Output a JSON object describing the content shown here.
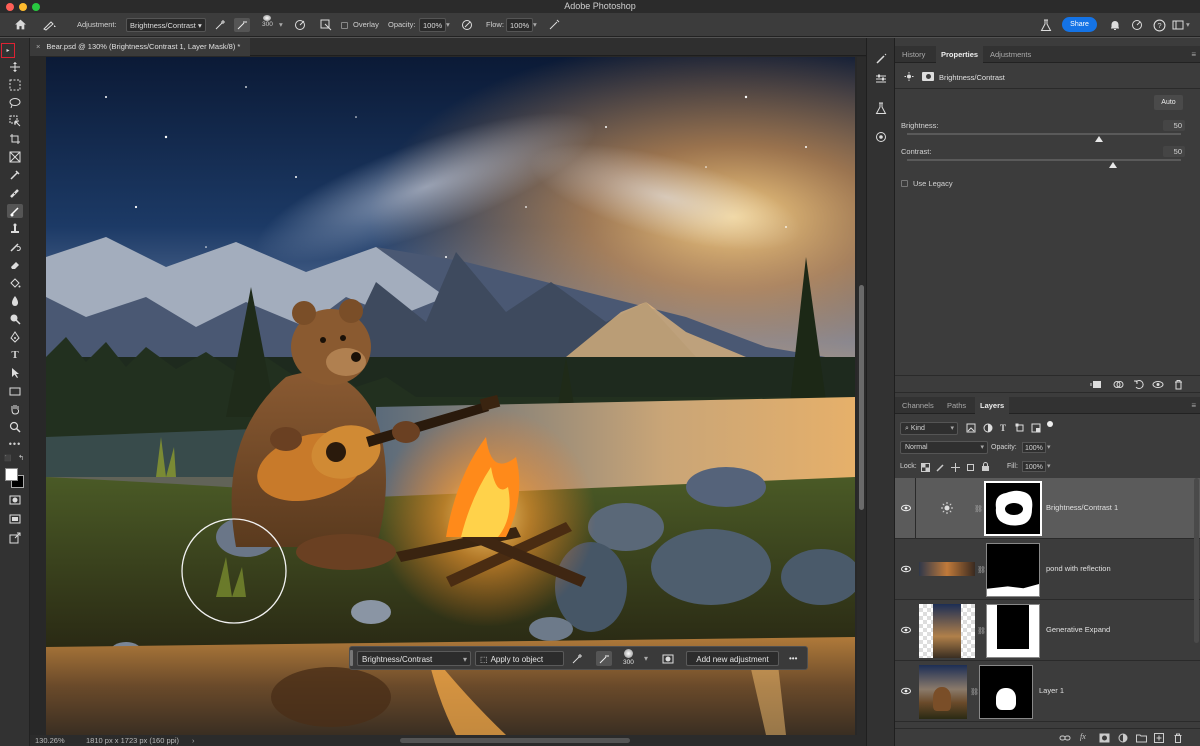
{
  "app": {
    "title": "Adobe Photoshop",
    "share_label": "Share"
  },
  "colors": {
    "accent": "#1473e6",
    "panel_bg": "#3c3c3c",
    "toolbar_bg": "#323232"
  },
  "options_bar": {
    "adjustment_label": "Adjustment:",
    "adjustment_value": "Brightness/Contrast",
    "brush_size": "300",
    "overlay_label": "Overlay",
    "opacity_label": "Opacity:",
    "opacity_value": "100%",
    "flow_label": "Flow:",
    "flow_value": "100%"
  },
  "document": {
    "tab_label": "Bear.psd @ 130% (Brightness/Contrast 1, Layer Mask/8) *",
    "zoom": "130.26%",
    "dimensions": "1810 px x 1723 px (160 ppi)"
  },
  "taskbar": {
    "adjustment": "Brightness/Contrast",
    "apply_label": "Apply to object",
    "brush_size": "300",
    "add_label": "Add new adjustment",
    "more": "•••"
  },
  "properties_panel": {
    "tabs": [
      "History",
      "Properties",
      "Adjustments"
    ],
    "active_tab": "Properties",
    "header": "Brightness/Contrast",
    "auto_label": "Auto",
    "brightness_label": "Brightness:",
    "brightness_value": "50",
    "brightness_level": 0.7,
    "contrast_label": "Contrast:",
    "contrast_value": "50",
    "contrast_level": 0.75,
    "legacy_label": "Use Legacy"
  },
  "layers_panel": {
    "tabs": [
      "Channels",
      "Paths",
      "Layers"
    ],
    "active_tab": "Layers",
    "kind_label": "Kind",
    "blend_mode": "Normal",
    "opacity_label": "Opacity:",
    "opacity_value": "100%",
    "lock_label": "Lock:",
    "fill_label": "Fill:",
    "fill_value": "100%",
    "layers": [
      {
        "name": "Brightness/Contrast 1"
      },
      {
        "name": "pond with reflection"
      },
      {
        "name": "Generative Expand"
      },
      {
        "name": "Layer 1"
      }
    ]
  },
  "icons": [
    "home-icon",
    "brush-icon",
    "eraser-icon",
    "flask-icon",
    "bell-icon",
    "help-icon",
    "gear-icon",
    "eye-icon",
    "chain-icon",
    "sun-icon",
    "trash-icon",
    "fx-icon",
    "folder-icon",
    "new-layer-icon",
    "link-icon",
    "mask-icon"
  ]
}
